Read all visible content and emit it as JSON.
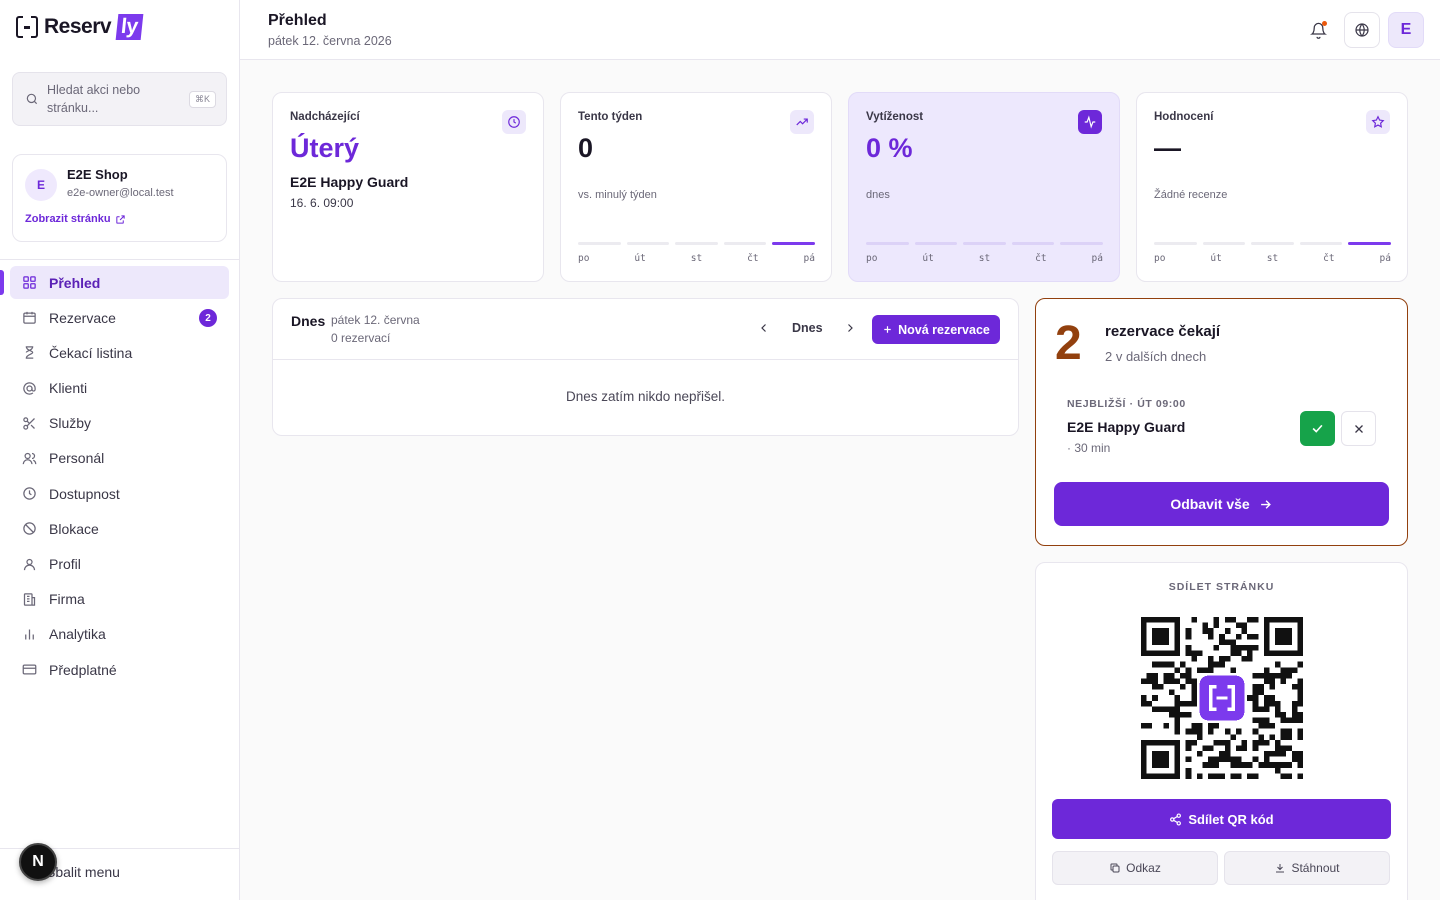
{
  "brand": {
    "name_main": "Reserv",
    "name_accent": "ly",
    "accent_color": "#6d28d9"
  },
  "search": {
    "placeholder": "Hledat akci nebo stránku...",
    "shortcut": "⌘K"
  },
  "shop": {
    "avatar": "E",
    "name": "E2E Shop",
    "email": "e2e-owner@local.test",
    "link_label": "Zobrazit stránku"
  },
  "sidebar": {
    "items": [
      {
        "label": "Přehled",
        "icon": "grid-icon",
        "active": true
      },
      {
        "label": "Rezervace",
        "icon": "calendar-icon",
        "badge": "2"
      },
      {
        "label": "Čekací listina",
        "icon": "hourglass-icon"
      },
      {
        "label": "Klienti",
        "icon": "at-icon"
      },
      {
        "label": "Služby",
        "icon": "scissors-icon"
      },
      {
        "label": "Personál",
        "icon": "users-icon"
      },
      {
        "label": "Dostupnost",
        "icon": "clock-icon"
      },
      {
        "label": "Blokace",
        "icon": "ban-icon"
      },
      {
        "label": "Profil",
        "icon": "user-icon"
      },
      {
        "label": "Firma",
        "icon": "building-icon"
      },
      {
        "label": "Analytika",
        "icon": "bar-chart-icon"
      },
      {
        "label": "Předplatné",
        "icon": "credit-card-icon"
      }
    ],
    "collapse_label": "Sbalit menu",
    "dev_badge": "N"
  },
  "header": {
    "title": "Přehled",
    "date": "pátek 12. června 2026",
    "avatar": "E"
  },
  "stats": {
    "upcoming": {
      "label": "Nadcházející",
      "value": "Úterý",
      "name": "E2E Happy Guard",
      "time": "16. 6. 09:00"
    },
    "week": {
      "label": "Tento týden",
      "value": "0",
      "sub": "vs. minulý týden"
    },
    "occupancy": {
      "label": "Vytíženost",
      "value": "0 %",
      "sub": "dnes"
    },
    "rating": {
      "label": "Hodnocení",
      "value": "—",
      "sub": "Žádné recenze"
    },
    "days": [
      "po",
      "út",
      "st",
      "čt",
      "pá"
    ]
  },
  "today": {
    "title": "Dnes",
    "date": "pátek 12. června",
    "count": "0 rezervací",
    "today_button": "Dnes",
    "new_button": "Nová rezervace",
    "empty": "Dnes zatím nikdo nepřišel."
  },
  "pending": {
    "count": "2",
    "title": "rezervace čekají",
    "sub": "2 v dalších dnech",
    "kicker": "NEJBLIŽŠÍ · ÚT 09:00",
    "name": "E2E Happy Guard",
    "duration": "· 30 min",
    "dispatch": "Odbavit vše"
  },
  "share": {
    "title": "SDÍLET STRÁNKU",
    "share_button": "Sdílet QR kód",
    "link_button": "Odkaz",
    "download_button": "Stáhnout"
  }
}
